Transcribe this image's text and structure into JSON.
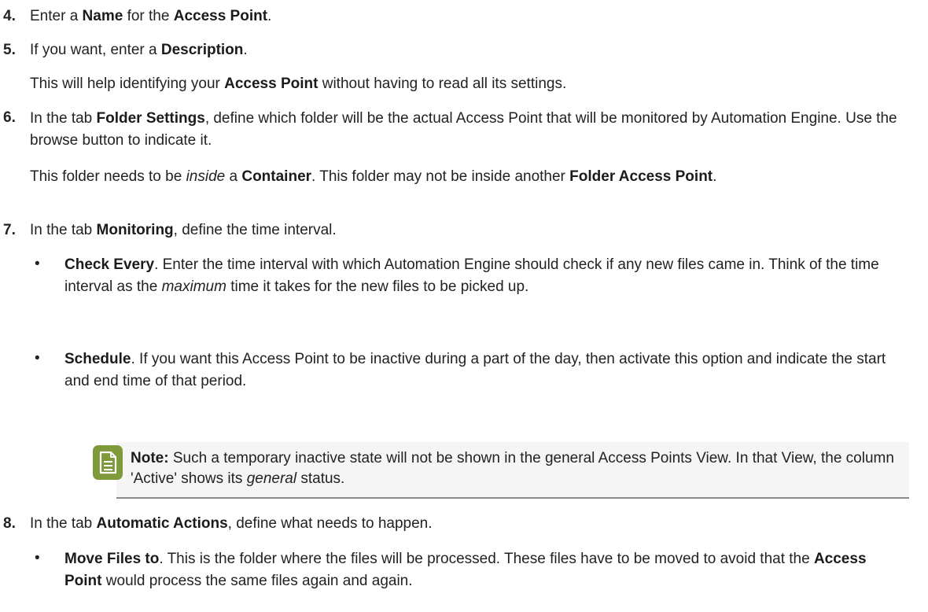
{
  "steps": [
    {
      "number": "4.",
      "parts": [
        {
          "t": "Enter a "
        },
        {
          "t": "Name",
          "b": true
        },
        {
          "t": " for the "
        },
        {
          "t": "Access Point",
          "b": true
        },
        {
          "t": "."
        }
      ]
    },
    {
      "number": "5.",
      "parts": [
        {
          "t": "If you want, enter a "
        },
        {
          "t": "Description",
          "b": true
        },
        {
          "t": "."
        }
      ],
      "para": [
        {
          "t": "This will help identifying your "
        },
        {
          "t": "Access Point",
          "b": true
        },
        {
          "t": " without having to read all its settings."
        }
      ]
    },
    {
      "number": "6.",
      "parts": [
        {
          "t": "In the tab "
        },
        {
          "t": "Folder Settings",
          "b": true
        },
        {
          "t": ", define which folder will be the actual Access Point that will be monitored by Automation Engine. Use the browse button to indicate it."
        }
      ],
      "para": [
        {
          "t": "This folder needs to be "
        },
        {
          "t": "inside",
          "i": true
        },
        {
          "t": " a "
        },
        {
          "t": "Container",
          "b": true
        },
        {
          "t": ". This folder may not be inside another "
        },
        {
          "t": "Folder Access Point",
          "b": true
        },
        {
          "t": "."
        }
      ]
    },
    {
      "number": "7.",
      "parts": [
        {
          "t": "In the tab "
        },
        {
          "t": "Monitoring",
          "b": true
        },
        {
          "t": ", define the time interval."
        }
      ],
      "bullets": [
        [
          {
            "t": "Check Every",
            "b": true
          },
          {
            "t": ". Enter the time interval with which Automation Engine should check if any new files came in. Think of the time interval as the "
          },
          {
            "t": "maximum",
            "i": true
          },
          {
            "t": " time it takes for the new files to be picked up."
          }
        ],
        [
          {
            "t": "Schedule",
            "b": true
          },
          {
            "t": ". If you want this Access Point to be inactive during a part of the day, then activate this option and indicate the start and end time of that period."
          }
        ]
      ],
      "note": [
        {
          "t": "Note:",
          "b": true
        },
        {
          "t": "  Such a temporary inactive state will not be shown in the general Access Points View. In that View, the column 'Active' shows its "
        },
        {
          "t": "general",
          "i": true
        },
        {
          "t": " status."
        }
      ]
    },
    {
      "number": "8.",
      "parts": [
        {
          "t": "In the tab "
        },
        {
          "t": "Automatic Actions",
          "b": true
        },
        {
          "t": ", define what needs to happen."
        }
      ],
      "bullets": [
        [
          {
            "t": "Move Files to",
            "b": true
          },
          {
            "t": ". This is the folder where the files will be processed. These files have to be moved to avoid that the "
          },
          {
            "t": "Access Point",
            "b": true
          },
          {
            "t": "  would process the same files again and again."
          }
        ]
      ]
    }
  ],
  "bullet_char": "•"
}
